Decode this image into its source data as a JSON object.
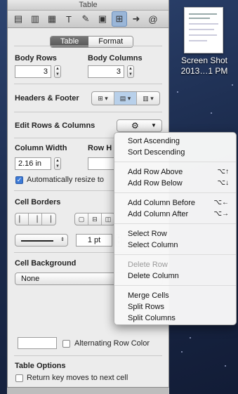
{
  "window": {
    "title": "Table"
  },
  "toolbar": {
    "buttons": [
      {
        "name": "document-inspector-icon",
        "glyph": "▤"
      },
      {
        "name": "layout-inspector-icon",
        "glyph": "▥"
      },
      {
        "name": "wrap-inspector-icon",
        "glyph": "▦"
      },
      {
        "name": "text-inspector-icon",
        "glyph": "T"
      },
      {
        "name": "graphic-inspector-icon",
        "glyph": "✎"
      },
      {
        "name": "metrics-inspector-icon",
        "glyph": "▣"
      },
      {
        "name": "table-inspector-icon",
        "glyph": "⊞"
      },
      {
        "name": "link-inspector-icon",
        "glyph": "➜"
      },
      {
        "name": "quicktime-inspector-icon",
        "glyph": "@"
      }
    ]
  },
  "tabs": {
    "table": "Table",
    "format": "Format"
  },
  "body_rows": {
    "label": "Body Rows",
    "value": "3"
  },
  "body_columns": {
    "label": "Body Columns",
    "value": "3"
  },
  "headers_footer": {
    "label": "Headers & Footer"
  },
  "edit_rows_columns": {
    "label": "Edit Rows & Columns"
  },
  "column_width": {
    "label": "Column Width",
    "value": "2.16 in"
  },
  "row_height": {
    "label": "Row H"
  },
  "auto_resize": {
    "label": "Automatically resize to",
    "checked": true
  },
  "cell_borders": {
    "label": "Cell Borders",
    "stroke_width": "1 pt"
  },
  "cell_background": {
    "label": "Cell Background",
    "fill": "None"
  },
  "alternating": {
    "label": "Alternating Row Color",
    "checked": false
  },
  "table_options": {
    "label": "Table Options",
    "return_key": "Return key moves to next cell"
  },
  "desktop_icon": {
    "line1": "Screen Shot",
    "line2": "2013…1 PM"
  },
  "menu": {
    "items": [
      {
        "label": "Sort Ascending",
        "shortcut": "",
        "disabled": false
      },
      {
        "label": "Sort Descending",
        "shortcut": "",
        "disabled": false
      },
      {
        "sep": true
      },
      {
        "label": "Add Row Above",
        "shortcut": "⌥↑",
        "disabled": false
      },
      {
        "label": "Add Row Below",
        "shortcut": "⌥↓",
        "disabled": false
      },
      {
        "sep": true
      },
      {
        "label": "Add Column Before",
        "shortcut": "⌥←",
        "disabled": false
      },
      {
        "label": "Add Column After",
        "shortcut": "⌥→",
        "disabled": false
      },
      {
        "sep": true
      },
      {
        "label": "Select Row",
        "shortcut": "",
        "disabled": false
      },
      {
        "label": "Select Column",
        "shortcut": "",
        "disabled": false
      },
      {
        "sep": true
      },
      {
        "label": "Delete Row",
        "shortcut": "",
        "disabled": true
      },
      {
        "label": "Delete Column",
        "shortcut": "",
        "disabled": false
      },
      {
        "sep": true
      },
      {
        "label": "Merge Cells",
        "shortcut": "",
        "disabled": false
      },
      {
        "label": "Split Rows",
        "shortcut": "",
        "disabled": false
      },
      {
        "label": "Split Columns",
        "shortcut": "",
        "disabled": false
      }
    ]
  },
  "colors": {
    "accent": "#3d7ad6",
    "selected_tab": "#666666",
    "desktop": "#1c2c4e"
  }
}
